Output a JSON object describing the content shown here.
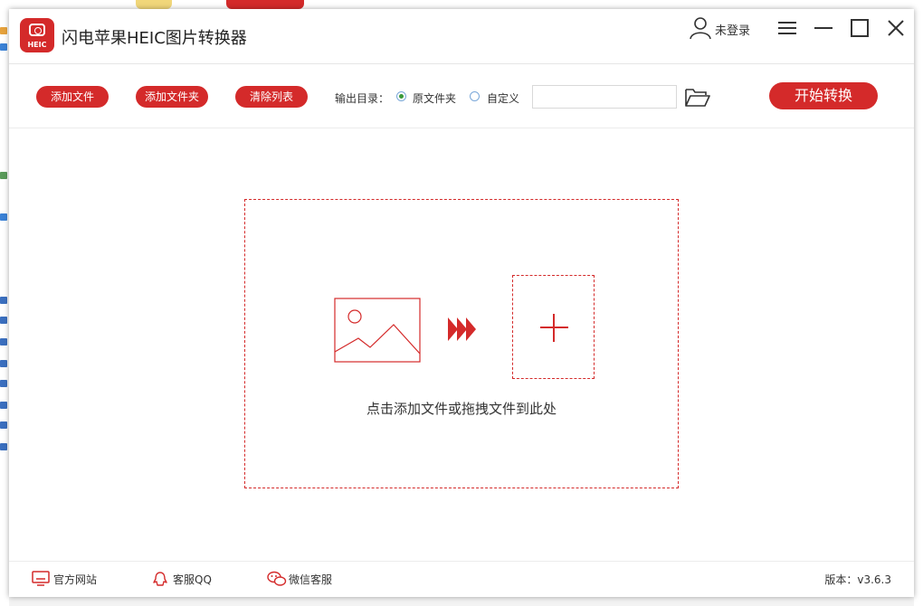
{
  "window": {
    "title": "闪电苹果HEIC图片转换器",
    "logo_text": "HEIC"
  },
  "user": {
    "login_label": "未登录"
  },
  "toolbar": {
    "add_file": "添加文件",
    "add_folder": "添加文件夹",
    "clear_list": "清除列表",
    "output_label": "输出目录：",
    "radio_original": "原文件夹",
    "radio_custom": "自定义",
    "path_value": "",
    "start": "开始转换"
  },
  "dropzone": {
    "hint": "点击添加文件或拖拽文件到此处"
  },
  "footer": {
    "website": "官方网站",
    "qq": "客服QQ",
    "wechat": "微信客服",
    "version": "版本：v3.6.3"
  },
  "colors": {
    "accent": "#d42a2a"
  }
}
